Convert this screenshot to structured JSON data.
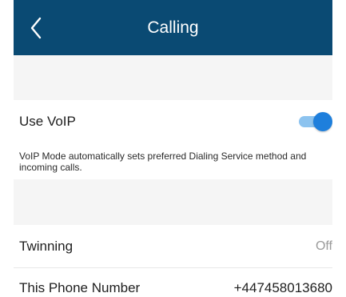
{
  "app_bar": {
    "title": "Calling",
    "back_icon": "chevron-left-icon",
    "background": "#0a4a73"
  },
  "settings": {
    "use_voip": {
      "label": "Use VoIP",
      "enabled": true,
      "toggle_color": "#1e7fdc",
      "description": "VoIP Mode automatically sets preferred Dialing Service method and incoming calls."
    },
    "twinning": {
      "label": "Twinning",
      "value": "Off"
    },
    "this_phone_number": {
      "label": "This Phone Number",
      "value": "+447458013680"
    }
  }
}
